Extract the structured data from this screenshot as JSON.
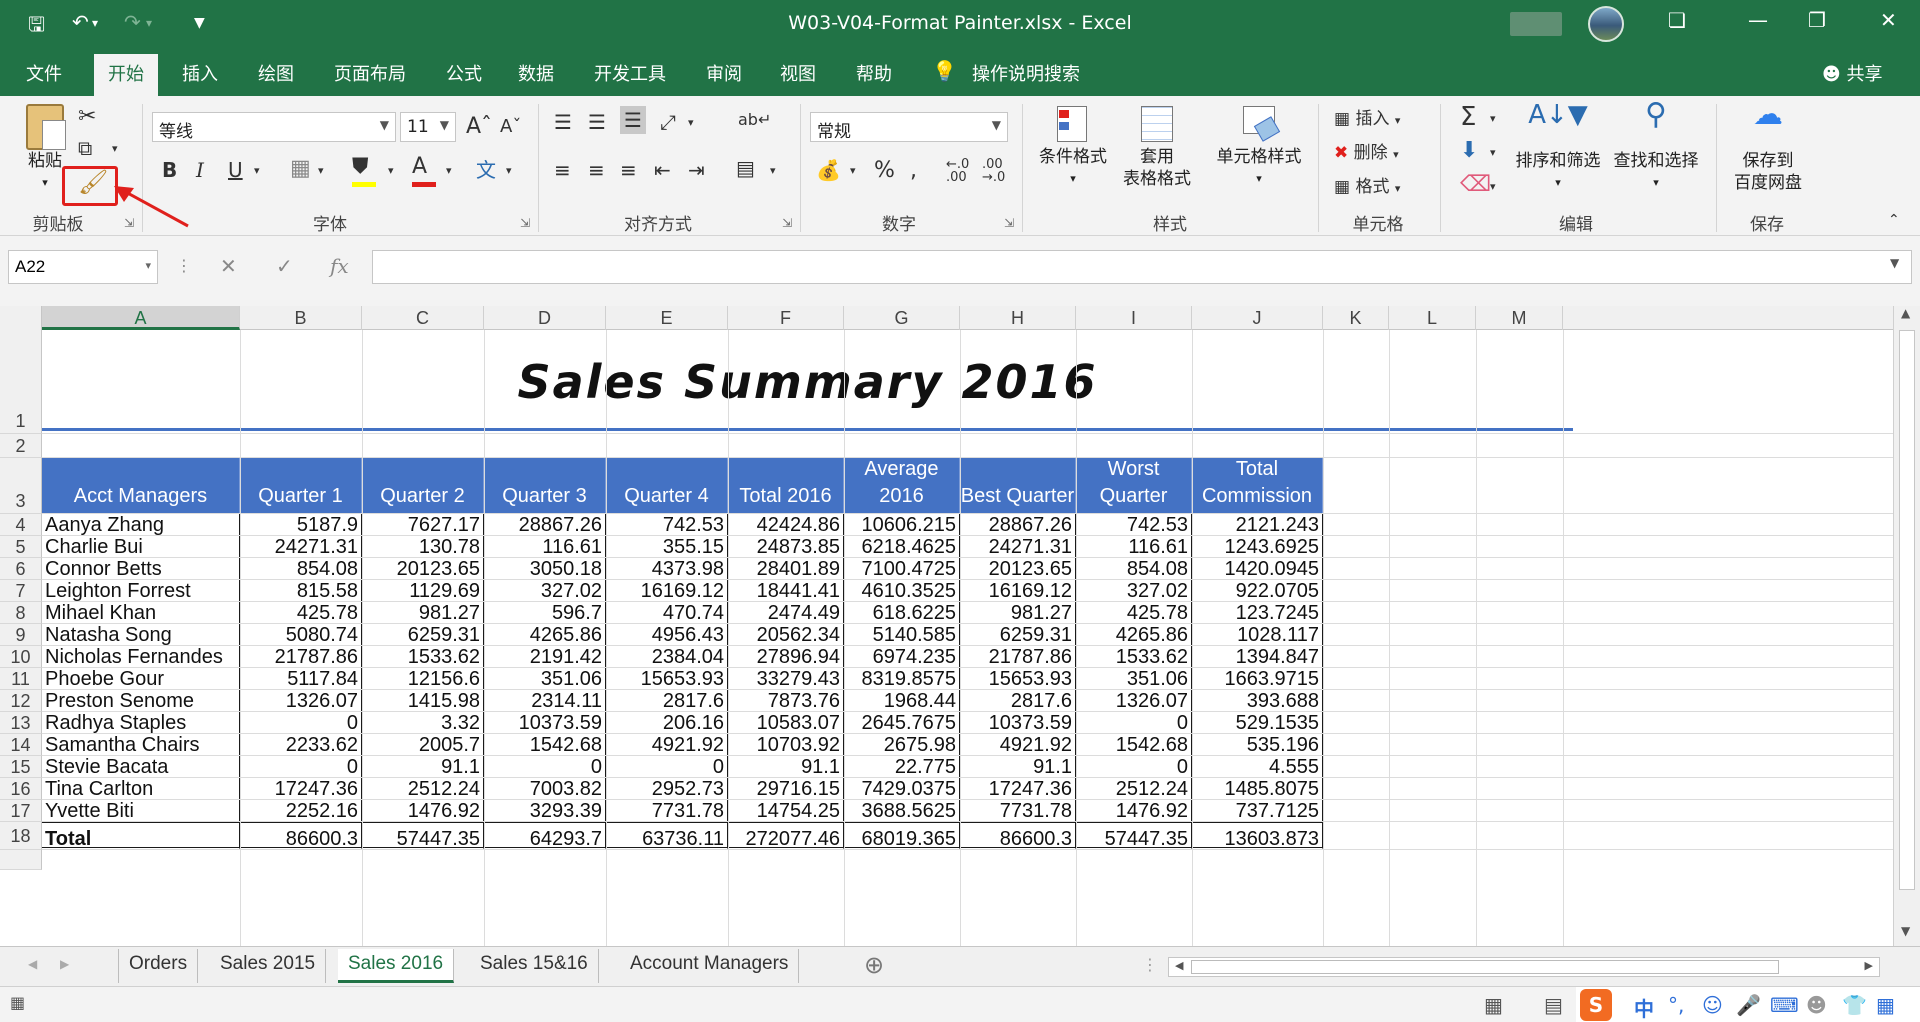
{
  "window": {
    "title": "W03-V04-Format Painter.xlsx  -  Excel",
    "controls": [
      "❐",
      "—",
      "❐",
      "✕"
    ]
  },
  "tabs": [
    "文件",
    "开始",
    "插入",
    "绘图",
    "页面布局",
    "公式",
    "数据",
    "开发工具",
    "审阅",
    "视图",
    "帮助"
  ],
  "active_tab": "开始",
  "tell_me": "操作说明搜索",
  "share": "共享",
  "ribbon": {
    "clipboard": {
      "paste": "粘贴",
      "label": "剪贴板"
    },
    "font": {
      "name": "等线",
      "size": "11",
      "label": "字体"
    },
    "alignment": {
      "label": "对齐方式"
    },
    "number": {
      "format": "常规",
      "label": "数字"
    },
    "styles": {
      "cond": "条件格式",
      "table1": "套用",
      "table2": "表格格式",
      "cell": "单元格样式",
      "label": "样式"
    },
    "cells": {
      "insert": "插入",
      "delete": "删除",
      "format": "格式",
      "label": "单元格"
    },
    "editing": {
      "sort": "排序和筛选",
      "find": "查找和选择",
      "label": "编辑"
    },
    "save": {
      "l1": "保存到",
      "l2": "百度网盘",
      "label": "保存"
    }
  },
  "namebox": "A22",
  "columns": [
    "A",
    "B",
    "C",
    "D",
    "E",
    "F",
    "G",
    "H",
    "I",
    "J",
    "K",
    "L",
    "M"
  ],
  "row_numbers": [
    "1",
    "2",
    "3",
    "4",
    "5",
    "6",
    "7",
    "8",
    "9",
    "10",
    "11",
    "12",
    "13",
    "14",
    "15",
    "16",
    "17",
    "18"
  ],
  "sheet_title": "Sales Summary 2016",
  "header_row": [
    "Acct Managers",
    "Quarter 1",
    "Quarter 2",
    "Quarter 3",
    "Quarter 4",
    "Total 2016",
    "Average 2016",
    "Best Quarter",
    "Worst Quarter",
    "Total Commission"
  ],
  "rows": [
    [
      "Aanya Zhang",
      "5187.9",
      "7627.17",
      "28867.26",
      "742.53",
      "42424.86",
      "10606.215",
      "28867.26",
      "742.53",
      "2121.243"
    ],
    [
      "Charlie Bui",
      "24271.31",
      "130.78",
      "116.61",
      "355.15",
      "24873.85",
      "6218.4625",
      "24271.31",
      "116.61",
      "1243.6925"
    ],
    [
      "Connor Betts",
      "854.08",
      "20123.65",
      "3050.18",
      "4373.98",
      "28401.89",
      "7100.4725",
      "20123.65",
      "854.08",
      "1420.0945"
    ],
    [
      "Leighton Forrest",
      "815.58",
      "1129.69",
      "327.02",
      "16169.12",
      "18441.41",
      "4610.3525",
      "16169.12",
      "327.02",
      "922.0705"
    ],
    [
      "Mihael Khan",
      "425.78",
      "981.27",
      "596.7",
      "470.74",
      "2474.49",
      "618.6225",
      "981.27",
      "425.78",
      "123.7245"
    ],
    [
      "Natasha Song",
      "5080.74",
      "6259.31",
      "4265.86",
      "4956.43",
      "20562.34",
      "5140.585",
      "6259.31",
      "4265.86",
      "1028.117"
    ],
    [
      "Nicholas Fernandes",
      "21787.86",
      "1533.62",
      "2191.42",
      "2384.04",
      "27896.94",
      "6974.235",
      "21787.86",
      "1533.62",
      "1394.847"
    ],
    [
      "Phoebe Gour",
      "5117.84",
      "12156.6",
      "351.06",
      "15653.93",
      "33279.43",
      "8319.8575",
      "15653.93",
      "351.06",
      "1663.9715"
    ],
    [
      "Preston Senome",
      "1326.07",
      "1415.98",
      "2314.11",
      "2817.6",
      "7873.76",
      "1968.44",
      "2817.6",
      "1326.07",
      "393.688"
    ],
    [
      "Radhya Staples",
      "0",
      "3.32",
      "10373.59",
      "206.16",
      "10583.07",
      "2645.7675",
      "10373.59",
      "0",
      "529.1535"
    ],
    [
      "Samantha Chairs",
      "2233.62",
      "2005.7",
      "1542.68",
      "4921.92",
      "10703.92",
      "2675.98",
      "4921.92",
      "1542.68",
      "535.196"
    ],
    [
      "Stevie Bacata",
      "0",
      "91.1",
      "0",
      "0",
      "91.1",
      "22.775",
      "91.1",
      "0",
      "4.555"
    ],
    [
      "Tina Carlton",
      "17247.36",
      "2512.24",
      "7003.82",
      "2952.73",
      "29716.15",
      "7429.0375",
      "17247.36",
      "2512.24",
      "1485.8075"
    ],
    [
      "Yvette Biti",
      "2252.16",
      "1476.92",
      "3293.39",
      "7731.78",
      "14754.25",
      "3688.5625",
      "7731.78",
      "1476.92",
      "737.7125"
    ]
  ],
  "total_row": [
    "Total",
    "86600.3",
    "57447.35",
    "64293.7",
    "63736.11",
    "272077.46",
    "68019.365",
    "86600.3",
    "57447.35",
    "13603.873"
  ],
  "sheet_tabs": [
    "Orders",
    "Sales 2015",
    "Sales 2016",
    "Sales 15&16",
    "Account Managers"
  ],
  "active_sheet": "Sales 2016",
  "colors": {
    "excel_green": "#217346",
    "header_blue": "#4472c4",
    "callout_red": "#e0201c"
  }
}
